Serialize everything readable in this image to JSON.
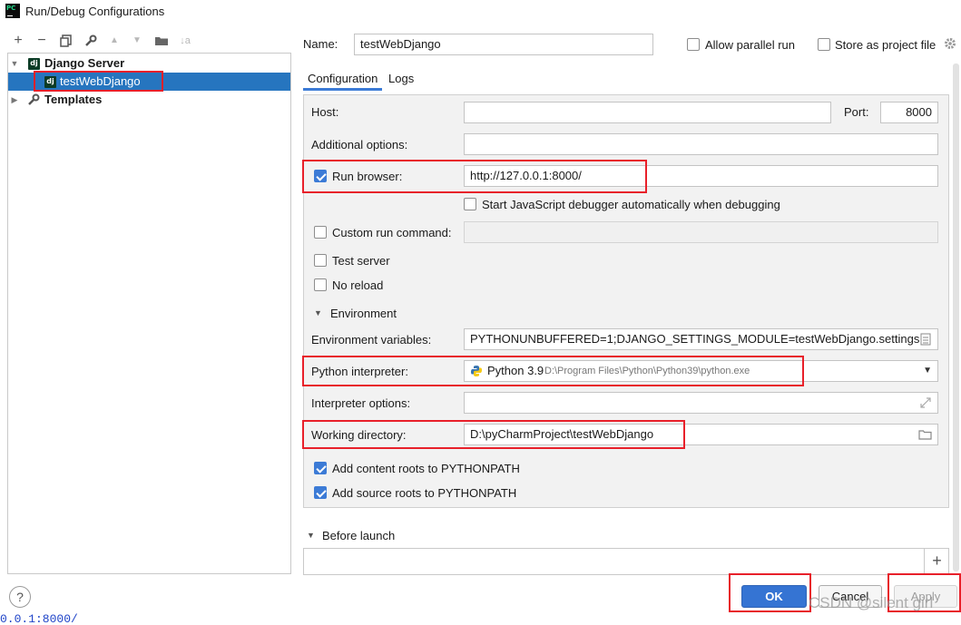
{
  "window": {
    "title": "Run/Debug Configurations",
    "app_icon_text": "PC"
  },
  "toolbar": {
    "add": "+",
    "remove": "−",
    "copy": "⎘",
    "edit_templates": "🔧",
    "move_up": "▲",
    "move_down": "▼",
    "folder": "📁",
    "sort": "↓a"
  },
  "tree": {
    "group_label": "Django Server",
    "item_label": "testWebDjango",
    "templates_label": "Templates",
    "dj_badge": "dj"
  },
  "header": {
    "name_label": "Name:",
    "name_value": "testWebDjango",
    "allow_parallel_label": "Allow parallel run",
    "store_project_label": "Store as project file"
  },
  "tabs": [
    "Configuration",
    "Logs"
  ],
  "form": {
    "host_label": "Host:",
    "host_value": "",
    "port_label": "Port:",
    "port_value": "8000",
    "additional_label": "Additional options:",
    "additional_value": "",
    "run_browser_label": "Run browser:",
    "run_browser_checked": true,
    "run_browser_value": "http://127.0.0.1:8000/",
    "js_debug_label": "Start JavaScript debugger automatically when debugging",
    "js_debug_checked": false,
    "custom_run_label": "Custom run command:",
    "custom_run_checked": false,
    "test_server_label": "Test server",
    "test_server_checked": false,
    "no_reload_label": "No reload",
    "no_reload_checked": false,
    "environment_section": "Environment",
    "env_vars_label": "Environment variables:",
    "env_vars_value": "PYTHONUNBUFFERED=1;DJANGO_SETTINGS_MODULE=testWebDjango.settings",
    "interpreter_label": "Python interpreter:",
    "interpreter_name": "Python 3.9",
    "interpreter_path": "D:\\Program Files\\Python\\Python39\\python.exe",
    "interp_options_label": "Interpreter options:",
    "interp_options_value": "",
    "working_dir_label": "Working directory:",
    "working_dir_value": "D:\\pyCharmProject\\testWebDjango",
    "content_roots_label": "Add content roots to PYTHONPATH",
    "content_roots_checked": true,
    "source_roots_label": "Add source roots to PYTHONPATH",
    "source_roots_checked": true
  },
  "before_launch": {
    "label": "Before launch",
    "add": "+"
  },
  "buttons": {
    "ok": "OK",
    "cancel": "Cancel",
    "apply": "Apply",
    "help": "?"
  },
  "watermark": "CSDN @silent girl",
  "bottom_url": "0.0.1:8000/",
  "colors": {
    "selection": "#2675bf",
    "accent": "#3c7bd6",
    "highlight_box": "#e8202a",
    "ok_button": "#3574d3"
  }
}
